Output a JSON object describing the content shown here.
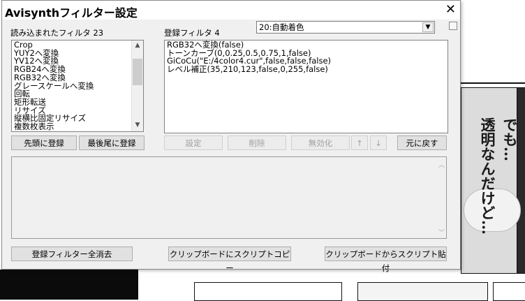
{
  "window": {
    "title": "Avisynthフィルター設定",
    "close_glyph": "✕"
  },
  "loaded_filters": {
    "label": "読み込まれたフィルタ 23",
    "items": [
      "Crop",
      "YUY2へ変換",
      "YV12へ変換",
      "RGB24へ変換",
      "RGB32へ変換",
      "グレースケールへ変換",
      "回転",
      "矩形転送",
      "リサイズ",
      "縦横比固定リサイズ",
      "複数枚表示"
    ]
  },
  "registered_filters": {
    "label": "登録フィルタ 4",
    "items": [
      "RGB32へ変換(false)",
      "トーンカーブ(0,0.25,0.5,0.75,1,false)",
      "GiCoCu(\"E:/4color4.cur\",false,false,false)",
      "レベル補正(35,210,123,false,0,255,false)"
    ]
  },
  "preset_select": {
    "value": "20:自動着色"
  },
  "buttons": {
    "register_head": "先頭に登録",
    "register_tail": "最後尾に登録",
    "settings": "設定",
    "delete": "削除",
    "disable": "無効化",
    "up": "↑",
    "down": "↓",
    "restore": "元に戻す",
    "clear_all": "登録フィルター全消去",
    "copy_script": "クリップボードにスクリプトコピー",
    "paste_script": "クリップボードからスクリプト貼付"
  },
  "background": {
    "bubble_lines": [
      "でも…",
      "透明なんだけど…"
    ]
  }
}
